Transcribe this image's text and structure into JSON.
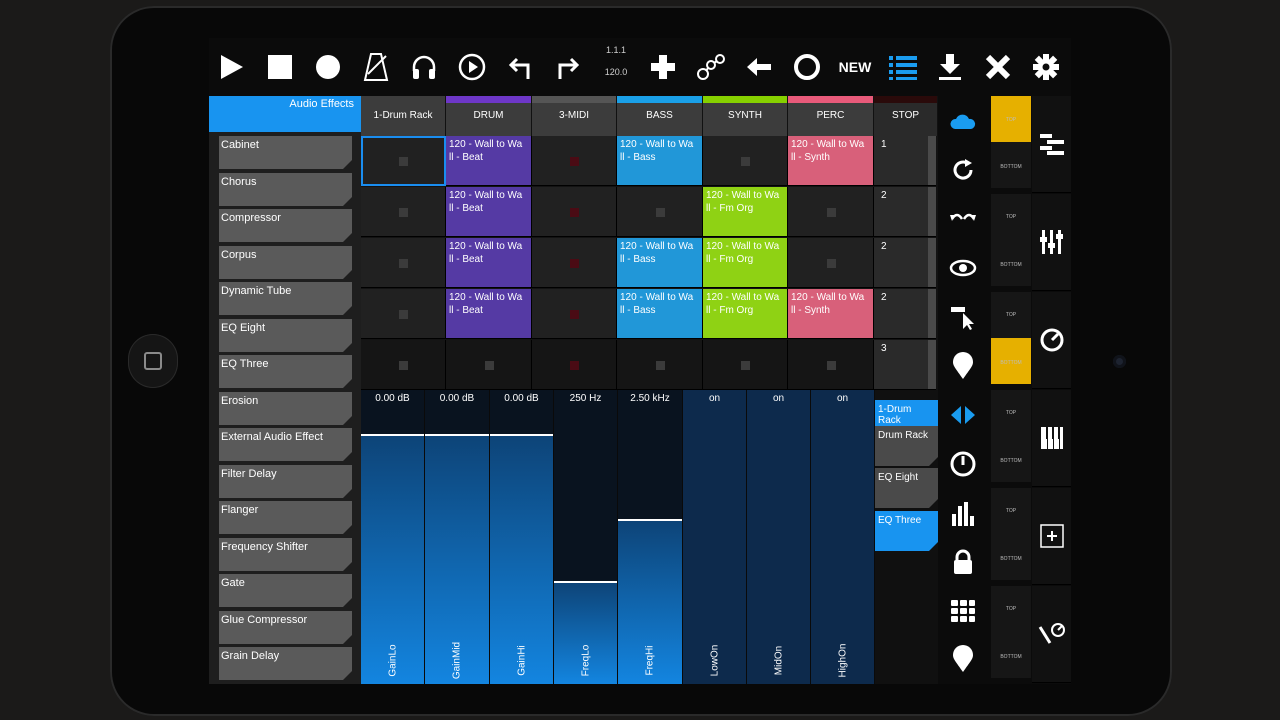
{
  "toolbar": {
    "play": "play-icon",
    "stop": "stop-icon",
    "record": "record-icon",
    "metronome": "metronome-icon",
    "headphones": "headphones-icon",
    "follow": "follow-icon",
    "undo": "undo-icon",
    "redo": "redo-icon",
    "position": "1.1.1",
    "tempo": "120.0",
    "add": "plus-icon",
    "link": "link-icon",
    "back": "back-arrow-icon",
    "circle": "circle-icon",
    "new_label": "NEW",
    "list": "list-icon",
    "download": "download-icon",
    "close": "close-icon",
    "settings": "gear-icon"
  },
  "browser": {
    "title": "Audio Effects",
    "items": [
      "Cabinet",
      "Chorus",
      "Compressor",
      "Corpus",
      "Dynamic Tube",
      "EQ Eight",
      "EQ Three",
      "Erosion",
      "External Audio Effect",
      "Filter Delay",
      "Flanger",
      "Frequency Shifter",
      "Gate",
      "Glue Compressor",
      "Grain Delay"
    ]
  },
  "tracks": [
    {
      "name": "1-Drum Rack",
      "color": "#3c3c3c"
    },
    {
      "name": "DRUM",
      "color": "#6e37c8"
    },
    {
      "name": "3-MIDI",
      "color": "#555555"
    },
    {
      "name": "BASS",
      "color": "#1aa0e8"
    },
    {
      "name": "SYNTH",
      "color": "#86d000"
    },
    {
      "name": "PERC",
      "color": "#e85a7a"
    }
  ],
  "stop_all_label": "STOP",
  "clips": {
    "beat": "120 - Wall to Wa ll - Beat",
    "bass": "120 - Wall to Wa ll - Bass",
    "fm": "120 - Wall to Wa ll - Fm Org",
    "synth": "120 - Wall to Wa ll - Synth"
  },
  "clip_colors": {
    "drum": "#553aa4",
    "bass": "#2197d8",
    "synth": "#8fd214",
    "perc": "#d8607a"
  },
  "scenes": [
    "1",
    "2",
    "2",
    "2",
    "3"
  ],
  "params": [
    {
      "value": "0.00 dB",
      "name": "GainLo",
      "level": 0.85
    },
    {
      "value": "0.00 dB",
      "name": "GainMid",
      "level": 0.85
    },
    {
      "value": "0.00 dB",
      "name": "GainHi",
      "level": 0.85
    },
    {
      "value": "250 Hz",
      "name": "FreqLo",
      "level": 0.35
    },
    {
      "value": "2.50 kHz",
      "name": "FreqHi",
      "level": 0.56
    },
    {
      "value": "on",
      "name": "LowOn",
      "level": 1
    },
    {
      "value": "on",
      "name": "MidOn",
      "level": 1
    },
    {
      "value": "on",
      "name": "HighOn",
      "level": 1
    }
  ],
  "chain": [
    "1-Drum Rack",
    "Drum Rack",
    "EQ Eight",
    "EQ Three"
  ],
  "side_icons": [
    "cloud-icon",
    "refresh-icon",
    "undo-redo-icon",
    "eye-icon",
    "cursor-icon",
    "location-pin-icon",
    "left-right-arrows-icon",
    "power-icon",
    "equalizer-bars-icon",
    "lock-icon",
    "grid-icon",
    "location-pin-icon"
  ],
  "right_panel": {
    "top_label": "TOP",
    "bottom_label": "BOTTOM",
    "icons": [
      "layout-icon",
      "mixer-faders-icon",
      "dial-icon",
      "keyboard-icon",
      "add-box-icon",
      "pencil-dial-icon"
    ]
  }
}
